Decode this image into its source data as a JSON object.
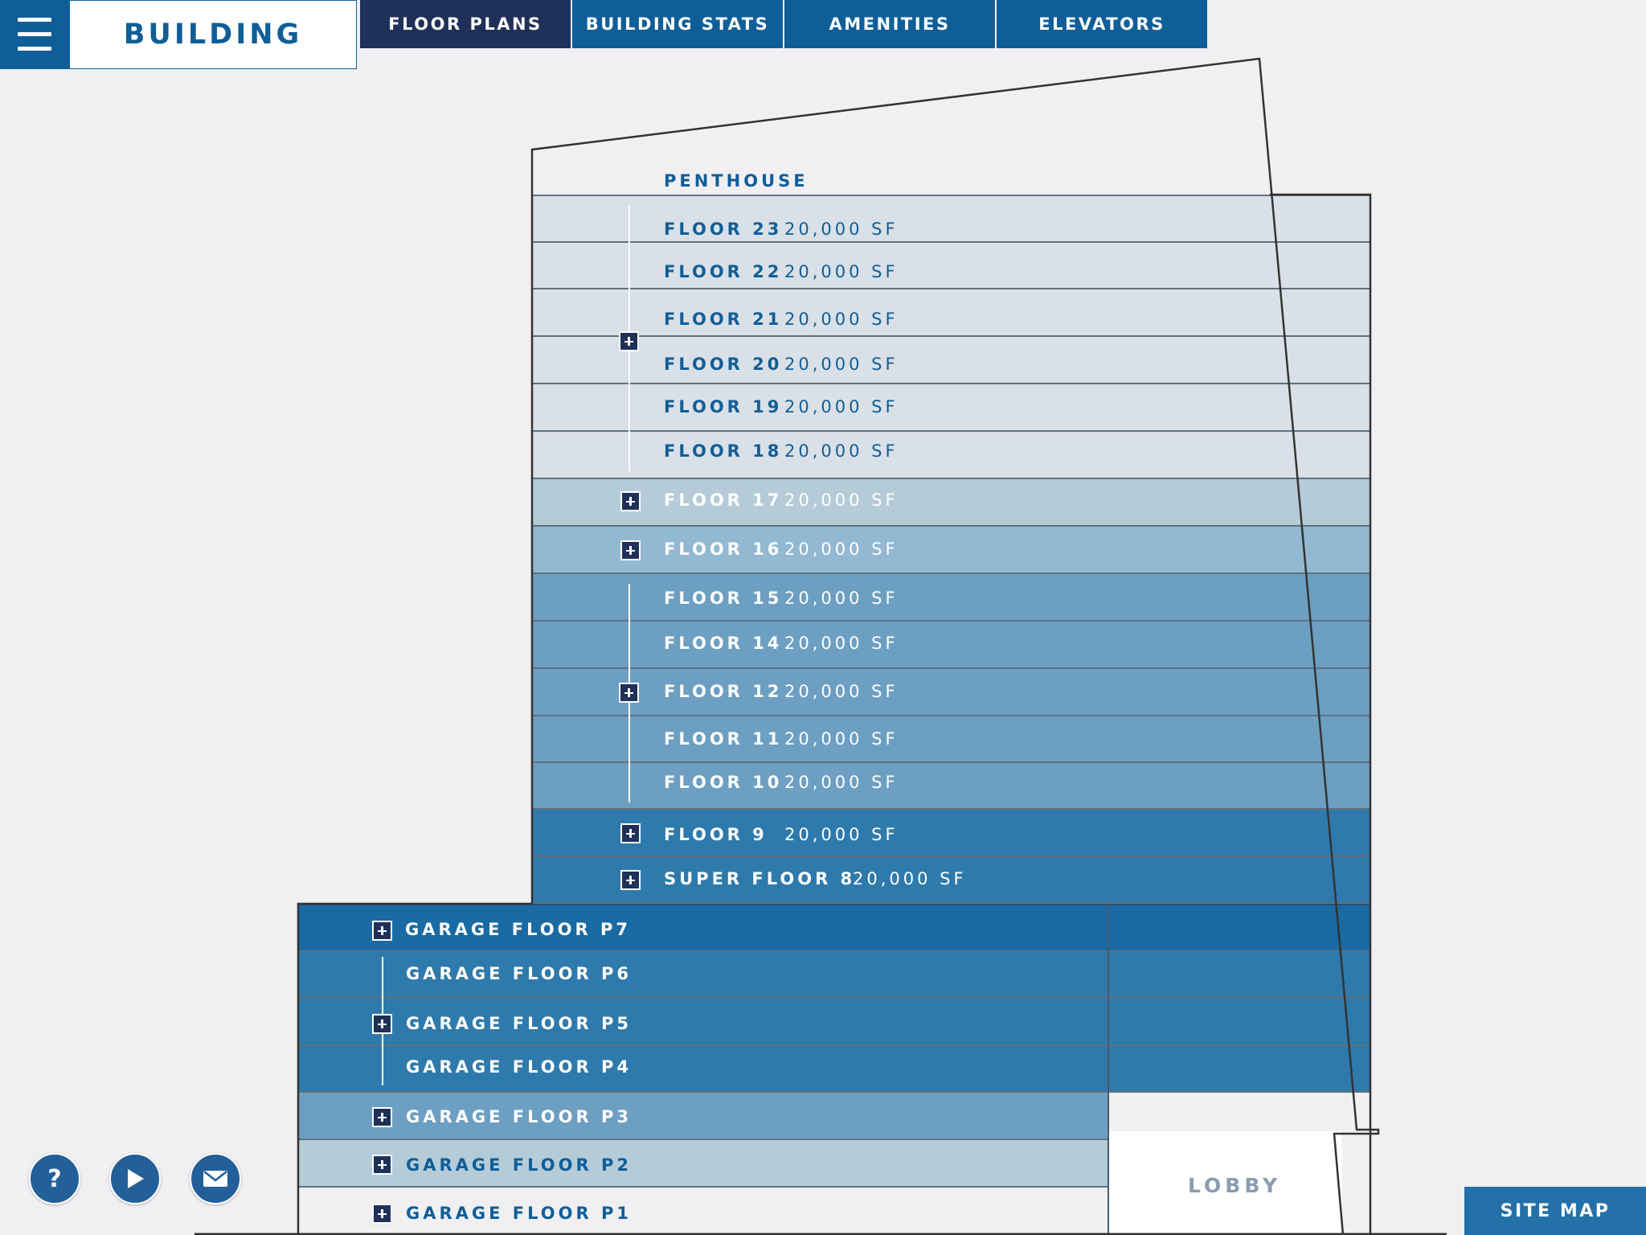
{
  "header": {
    "title": "BUILDING",
    "menu_icon": "hamburger-menu-icon",
    "tabs": [
      {
        "label": "FLOOR PLANS",
        "active": true
      },
      {
        "label": "BUILDING STATS",
        "active": false
      },
      {
        "label": "AMENITIES",
        "active": false
      },
      {
        "label": "ELEVATORS",
        "active": false
      }
    ]
  },
  "building": {
    "penthouse": "PENTHOUSE",
    "lobby": "LOBBY",
    "floors": [
      {
        "name": "FLOOR 23",
        "area": "20,000 SF"
      },
      {
        "name": "FLOOR 22",
        "area": "20,000 SF"
      },
      {
        "name": "FLOOR 21",
        "area": "20,000 SF"
      },
      {
        "name": "FLOOR 20",
        "area": "20,000 SF"
      },
      {
        "name": "FLOOR 19",
        "area": "20,000 SF"
      },
      {
        "name": "FLOOR 18",
        "area": "20,000 SF"
      },
      {
        "name": "FLOOR 17",
        "area": "20,000 SF"
      },
      {
        "name": "FLOOR 16",
        "area": "20,000 SF"
      },
      {
        "name": "FLOOR 15",
        "area": "20,000 SF"
      },
      {
        "name": "FLOOR 14",
        "area": "20,000 SF"
      },
      {
        "name": "FLOOR 12",
        "area": "20,000 SF"
      },
      {
        "name": "FLOOR 11",
        "area": "20,000 SF"
      },
      {
        "name": "FLOOR 10",
        "area": "20,000 SF"
      },
      {
        "name": "FLOOR 9",
        "area": "20,000 SF"
      },
      {
        "name": "SUPER FLOOR 8",
        "area": "20,000 SF"
      }
    ],
    "garage": [
      {
        "name": "GARAGE FLOOR P7"
      },
      {
        "name": "GARAGE FLOOR P6"
      },
      {
        "name": "GARAGE FLOOR P5"
      },
      {
        "name": "GARAGE FLOOR P4"
      },
      {
        "name": "GARAGE FLOOR P3"
      },
      {
        "name": "GARAGE FLOOR P2"
      },
      {
        "name": "GARAGE FLOOR P1"
      }
    ],
    "colors": {
      "upper": "#dae0e7",
      "mid_light": "#b5cbd8",
      "mid": "#93b8d1",
      "mid_dark": "#6d9fc2",
      "dark": "#2f7aac",
      "darkest": "#1a6aa3",
      "label_dark": "#0f5e97"
    }
  },
  "footer": {
    "buttons": [
      {
        "icon": "help-icon",
        "glyph": "?"
      },
      {
        "icon": "play-icon"
      },
      {
        "icon": "mail-icon"
      }
    ],
    "site_map": "SITE MAP"
  }
}
